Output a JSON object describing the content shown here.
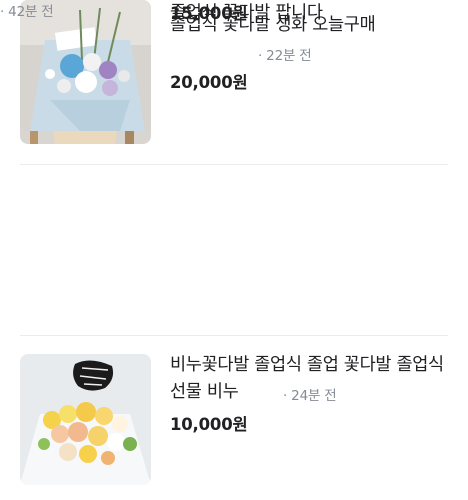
{
  "listings": [
    {
      "title": "졸업식 꽃다발 생화 오늘구매",
      "meta": "· 22분 전",
      "price": "20,000원",
      "thumbnail": "bouquet-photo-1"
    },
    {
      "title": "비누꽃다발 졸업식 졸업 꽃다발 졸업식 선물 비누",
      "meta": "· 24분 전",
      "price": "10,000원",
      "thumbnail": "bouquet-photo-2"
    },
    {
      "title": "졸업식 꽃다발 팝니다",
      "meta": "· 42분 전",
      "price": "15,000원",
      "thumbnail": "bouquet-photo-3"
    }
  ]
}
